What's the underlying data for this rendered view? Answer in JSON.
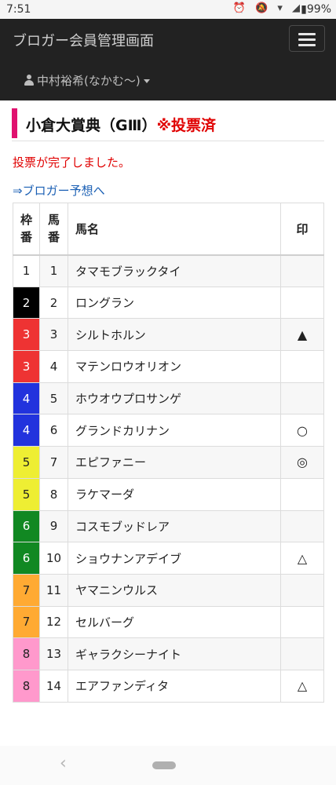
{
  "status_bar": {
    "time": "7:51",
    "battery": "99%"
  },
  "navbar": {
    "brand": "ブロガー会員管理画面",
    "user": "中村裕希(なかむ〜)"
  },
  "race": {
    "title": "小倉大賞典（GⅢ）",
    "status": "※投票済"
  },
  "message": "投票が完了しました。",
  "link_text": "⇒ブロガー予想へ",
  "table": {
    "headers": {
      "waku": [
        "枠",
        "番"
      ],
      "umaban": [
        "馬",
        "番"
      ],
      "name": "馬名",
      "mark": "印"
    },
    "rows": [
      {
        "waku": "1",
        "umaban": "1",
        "name": "タマモブラックタイ",
        "mark": ""
      },
      {
        "waku": "2",
        "umaban": "2",
        "name": "ロングラン",
        "mark": ""
      },
      {
        "waku": "3",
        "umaban": "3",
        "name": "シルトホルン",
        "mark": "▲"
      },
      {
        "waku": "3",
        "umaban": "4",
        "name": "マテンロウオリオン",
        "mark": ""
      },
      {
        "waku": "4",
        "umaban": "5",
        "name": "ホウオウプロサンゲ",
        "mark": ""
      },
      {
        "waku": "4",
        "umaban": "6",
        "name": "グランドカリナン",
        "mark": "○"
      },
      {
        "waku": "5",
        "umaban": "7",
        "name": "エピファニー",
        "mark": "◎"
      },
      {
        "waku": "5",
        "umaban": "8",
        "name": "ラケマーダ",
        "mark": ""
      },
      {
        "waku": "6",
        "umaban": "9",
        "name": "コスモブッドレア",
        "mark": ""
      },
      {
        "waku": "6",
        "umaban": "10",
        "name": "ショウナンアデイブ",
        "mark": "△"
      },
      {
        "waku": "7",
        "umaban": "11",
        "name": "ヤマニンウルス",
        "mark": ""
      },
      {
        "waku": "7",
        "umaban": "12",
        "name": "セルバーグ",
        "mark": ""
      },
      {
        "waku": "8",
        "umaban": "13",
        "name": "ギャラクシーナイト",
        "mark": ""
      },
      {
        "waku": "8",
        "umaban": "14",
        "name": "エアファンディタ",
        "mark": "△"
      }
    ]
  },
  "frame_colors": {
    "1": {
      "bg": "#ffffff",
      "fg": "#222222"
    },
    "2": {
      "bg": "#000000",
      "fg": "#ffffff"
    },
    "3": {
      "bg": "#ee3333",
      "fg": "#ffffff"
    },
    "4": {
      "bg": "#2233dd",
      "fg": "#ffffff"
    },
    "5": {
      "bg": "#eeee33",
      "fg": "#222222"
    },
    "6": {
      "bg": "#118822",
      "fg": "#ffffff"
    },
    "7": {
      "bg": "#ffaa33",
      "fg": "#222222"
    },
    "8": {
      "bg": "#ff99cc",
      "fg": "#222222"
    }
  }
}
